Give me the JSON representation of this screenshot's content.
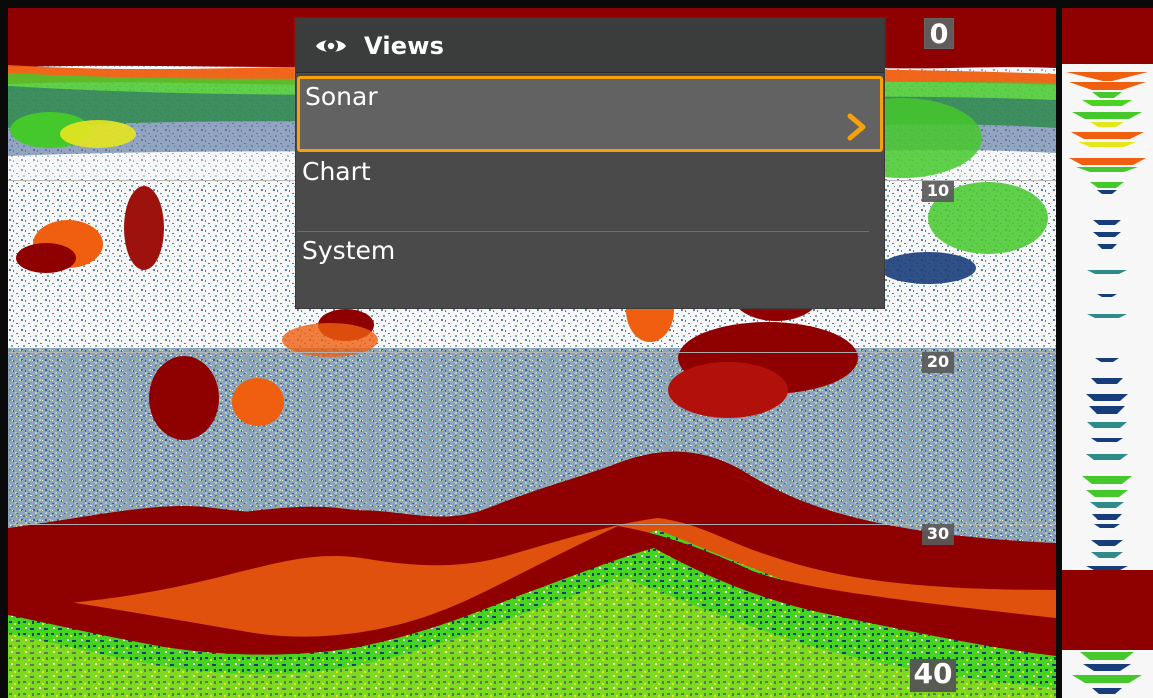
{
  "menu": {
    "title": "Views",
    "items": [
      {
        "label": "Sonar",
        "selected": true,
        "icon": "chevron-right-icon"
      },
      {
        "label": "Chart",
        "selected": false
      },
      {
        "label": "System",
        "selected": false
      }
    ]
  },
  "depth_scale": {
    "labels": [
      "0",
      "10",
      "20",
      "30",
      "40"
    ]
  },
  "icons": {
    "header": "eye-icon",
    "selected_item": "chevron-right-icon"
  },
  "colors": {
    "menu_background": "#4a4a4a",
    "menu_header": "#3a3d3b",
    "selected_item": "#626262",
    "selection_accent": "#f4a10b",
    "sonar_red": "#8f0000",
    "sonar_green": "#43d41f",
    "sonar_blue": "#173d7a",
    "sonar_yellow": "#e6e61f"
  }
}
